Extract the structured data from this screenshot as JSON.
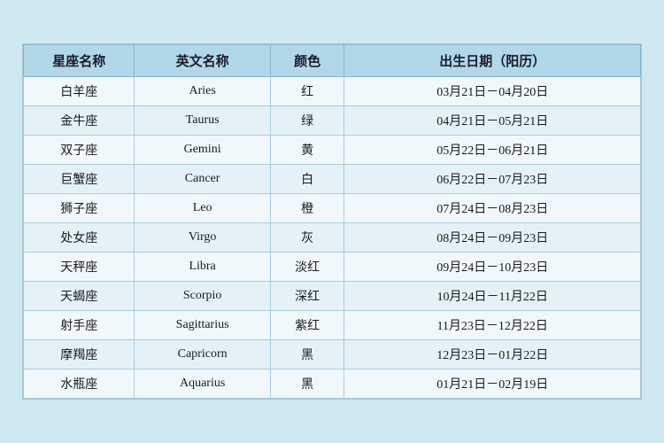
{
  "table": {
    "headers": {
      "cn_name": "星座名称",
      "en_name": "英文名称",
      "color": "颜色",
      "date": "出生日期（阳历）"
    },
    "rows": [
      {
        "cn": "白羊座",
        "en": "Aries",
        "color": "红",
        "date": "03月21日－04月20日"
      },
      {
        "cn": "金牛座",
        "en": "Taurus",
        "color": "绿",
        "date": "04月21日－05月21日"
      },
      {
        "cn": "双子座",
        "en": "Gemini",
        "color": "黄",
        "date": "05月22日－06月21日"
      },
      {
        "cn": "巨蟹座",
        "en": "Cancer",
        "color": "白",
        "date": "06月22日－07月23日"
      },
      {
        "cn": "狮子座",
        "en": "Leo",
        "color": "橙",
        "date": "07月24日－08月23日"
      },
      {
        "cn": "处女座",
        "en": "Virgo",
        "color": "灰",
        "date": "08月24日－09月23日"
      },
      {
        "cn": "天秤座",
        "en": "Libra",
        "color": "淡红",
        "date": "09月24日－10月23日"
      },
      {
        "cn": "天蝎座",
        "en": "Scorpio",
        "color": "深红",
        "date": "10月24日－11月22日"
      },
      {
        "cn": "射手座",
        "en": "Sagittarius",
        "color": "紫红",
        "date": "11月23日－12月22日"
      },
      {
        "cn": "摩羯座",
        "en": "Capricorn",
        "color": "黑",
        "date": "12月23日－01月22日"
      },
      {
        "cn": "水瓶座",
        "en": "Aquarius",
        "color": "黑",
        "date": "01月21日－02月19日"
      }
    ]
  }
}
